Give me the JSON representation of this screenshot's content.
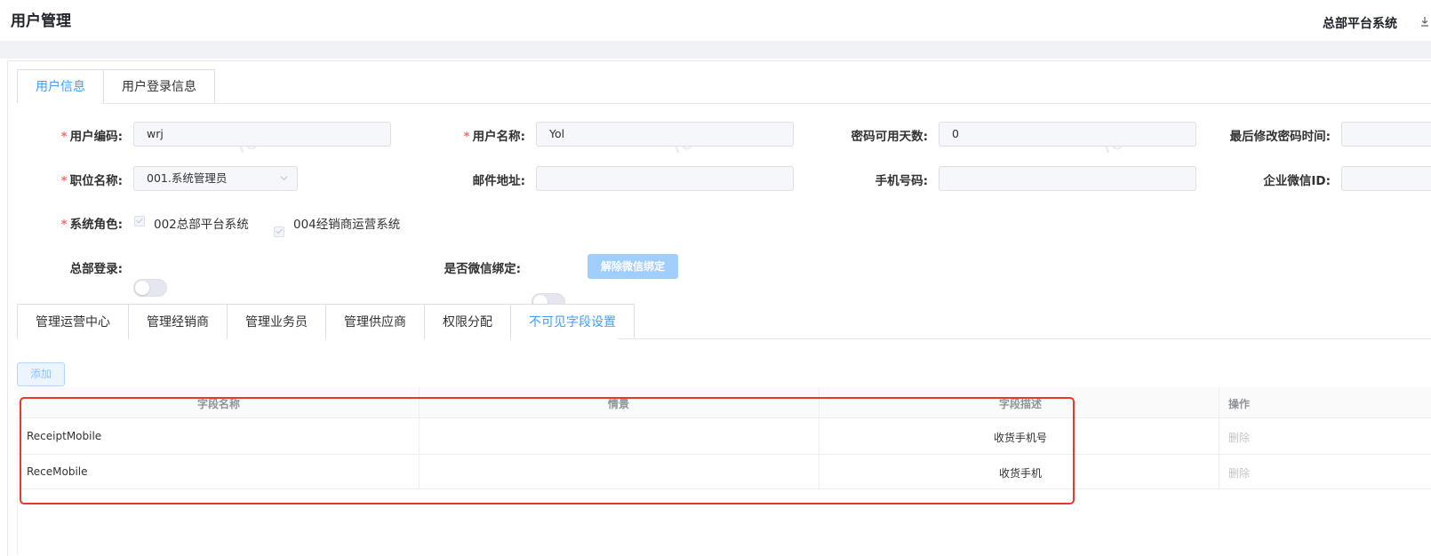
{
  "header": {
    "title": "用户管理",
    "system_name": "总部平台系统",
    "download_icon": "download-icon"
  },
  "main_tabs": [
    {
      "label": "用户信息",
      "active": true
    },
    {
      "label": "用户登录信息",
      "active": false
    }
  ],
  "form": {
    "user_code": {
      "label": "用户编码:",
      "value": "wrj",
      "required": true
    },
    "user_name": {
      "label": "用户名称:",
      "value": "Yol",
      "required": true
    },
    "pwd_days": {
      "label": "密码可用天数:",
      "value": "0"
    },
    "last_pwd_change": {
      "label": "最后修改密码时间:",
      "value": ""
    },
    "position": {
      "label": "职位名称:",
      "value": "001.系统管理员",
      "required": true
    },
    "email": {
      "label": "邮件地址:",
      "value": ""
    },
    "mobile": {
      "label": "手机号码:",
      "value": ""
    },
    "wechat_id": {
      "label": "企业微信ID:",
      "value": ""
    },
    "system_role": {
      "label": "系统角色:",
      "required": true,
      "options": [
        {
          "label": "002总部平台系统",
          "checked": true
        },
        {
          "label": "004经销商运营系统",
          "checked": true
        }
      ]
    },
    "hq_login": {
      "label": "总部登录:",
      "on": false
    },
    "wechat_bind": {
      "label": "是否微信绑定:",
      "on": false
    },
    "unbind_button": "解除微信绑定"
  },
  "sub_tabs": [
    {
      "label": "管理运营中心",
      "active": false
    },
    {
      "label": "管理经销商",
      "active": false
    },
    {
      "label": "管理业务员",
      "active": false
    },
    {
      "label": "管理供应商",
      "active": false
    },
    {
      "label": "权限分配",
      "active": false
    },
    {
      "label": "不可见字段设置",
      "active": true
    }
  ],
  "add_button": "添加",
  "table": {
    "columns": [
      "字段名称",
      "情景",
      "字段描述",
      "操作"
    ],
    "rows": [
      {
        "field": "ReceiptMobile",
        "scene": "",
        "desc": "收货手机号",
        "action": "删除"
      },
      {
        "field": "ReceMobile",
        "scene": "",
        "desc": "收货手机",
        "action": "删除"
      }
    ]
  },
  "watermark": "Yol",
  "colors": {
    "primary": "#409eff",
    "required": "#f56c6c",
    "highlight_border": "#e8392c"
  }
}
